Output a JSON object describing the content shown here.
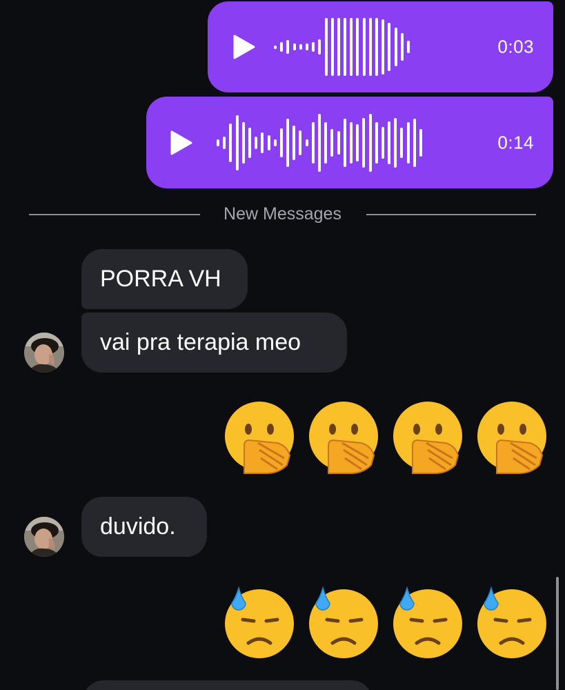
{
  "voice_messages": [
    {
      "duration": "0:03",
      "play_icon": "play-icon"
    },
    {
      "duration": "0:14",
      "play_icon": "play-icon"
    }
  ],
  "divider": {
    "label": "New Messages"
  },
  "messages": [
    {
      "sender": "other",
      "text": "PORRA VH"
    },
    {
      "sender": "other",
      "text": "vai pra terapia meo"
    },
    {
      "sender": "me",
      "emoji": "face-with-hand-over-mouth",
      "glyphs": "🤭🤭🤭🤭"
    },
    {
      "sender": "other",
      "text": "duvido."
    },
    {
      "sender": "me",
      "emoji": "downcast-face-with-sweat",
      "glyphs": "😓😓😓😓"
    }
  ],
  "colors": {
    "background": "#0c0d11",
    "sent_bubble": "#8a3ff2",
    "received_bubble": "#25272c",
    "divider_text": "#a3a6ae"
  }
}
